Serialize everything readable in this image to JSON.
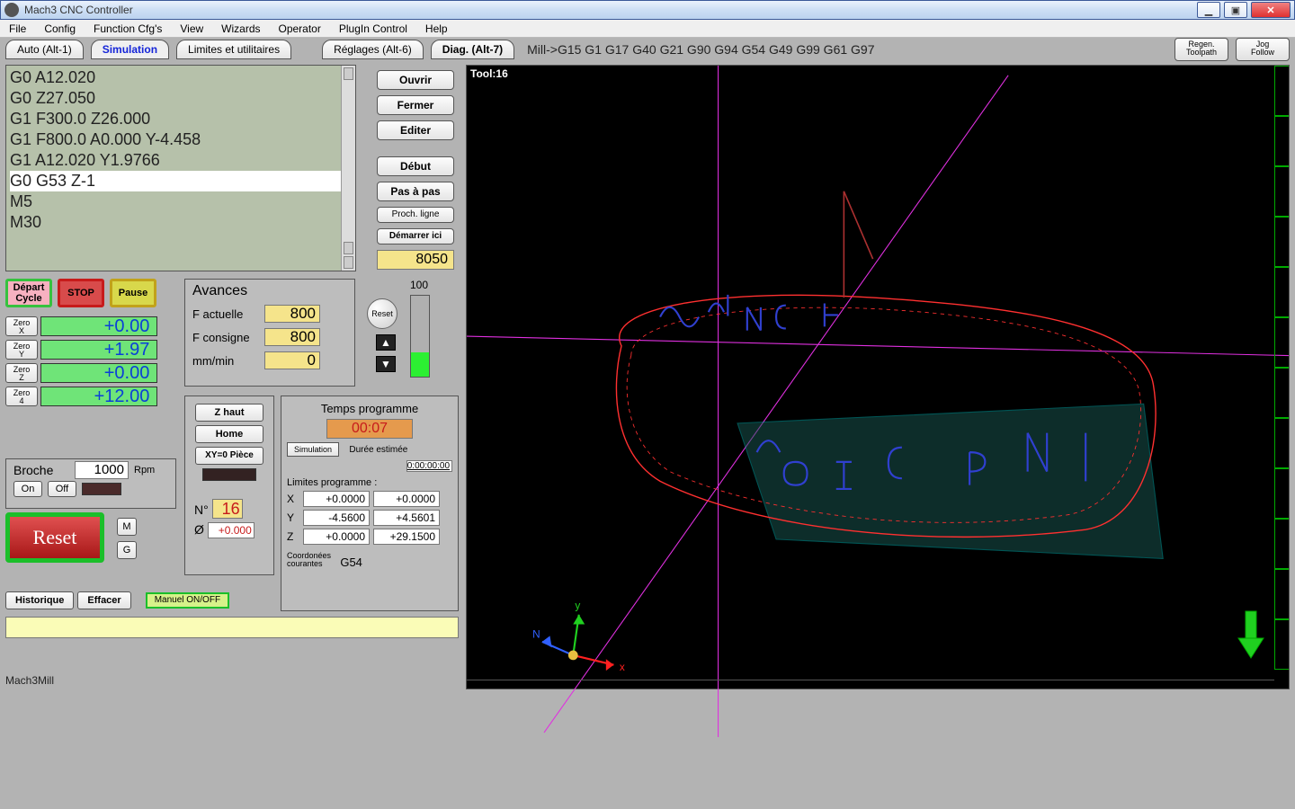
{
  "window": {
    "title": "Mach3 CNC Controller"
  },
  "menu": [
    "File",
    "Config",
    "Function Cfg's",
    "View",
    "Wizards",
    "Operator",
    "PlugIn Control",
    "Help"
  ],
  "tabs": {
    "auto": "Auto (Alt-1)",
    "sim": "Simulation",
    "limites": "Limites et utilitaires",
    "reglages": "Réglages (Alt-6)",
    "diag": "Diag. (Alt-7)"
  },
  "statusline": "Mill->G15  G1 G17 G40 G21 G90 G94 G54 G49 G99 G61 G97",
  "topright": {
    "regen": "Regen.\nToolpath",
    "jog": "Jog\nFollow"
  },
  "gcode": {
    "l1": "G0 A12.020",
    "l2": "G0 Z27.050",
    "l3": "G1 F300.0 Z26.000",
    "l4": "G1 F800.0 A0.000 Y-4.458",
    "l5": "G1 A12.020 Y1.9766",
    "l6": "G0 G53 Z-1",
    "l7": "M5",
    "l8": "M30"
  },
  "filebtns": {
    "ouvrir": "Ouvrir",
    "fermer": "Fermer",
    "editer": "Editer",
    "debut": "Début",
    "pas": "Pas à pas",
    "proch": "Proch. ligne",
    "demarrer": "Démarrer ici",
    "line": "8050"
  },
  "run": {
    "depart": "Départ\nCycle",
    "stop": "STOP",
    "pause": "Pause"
  },
  "zero": {
    "x": {
      "btn": "Zero\nX",
      "val": "+0.00"
    },
    "y": {
      "btn": "Zero\nY",
      "val": "+1.97"
    },
    "z": {
      "btn": "Zero\nZ",
      "val": "+0.00"
    },
    "a": {
      "btn": "Zero\n4",
      "val": "+12.00"
    }
  },
  "feed": {
    "title": "Avances",
    "actual_l": "F actuelle",
    "actual_v": "800",
    "cons_l": "F consigne",
    "cons_v": "800",
    "unit_l": "mm/min",
    "unit_v": "0",
    "reset": "Reset",
    "ov100": "100"
  },
  "broche": {
    "label": "Broche",
    "val": "1000",
    "rpm": "Rpm",
    "on": "On",
    "off": "Off"
  },
  "home": {
    "zhaut": "Z haut",
    "home": "Home",
    "xy0": "XY=0 Pièce",
    "n": "N°",
    "nval": "16",
    "dia": "Ø",
    "diaval": "+0.000"
  },
  "time": {
    "label": "Temps programme",
    "val": "00:07",
    "sim": "Simulation",
    "dur_l": "Durée estimée",
    "dur_v": "0:00:00:00",
    "lim_l": "Limites programme :",
    "x": {
      "min": "+0.0000",
      "max": "+0.0000"
    },
    "y": {
      "min": "-4.5600",
      "max": "+4.5601"
    },
    "z": {
      "min": "+0.0000",
      "max": "+29.1500"
    },
    "coord_l": "Coordonées\ncourantes",
    "coord_v": "G54"
  },
  "reset": {
    "label": "Reset",
    "m": "M",
    "g": "G"
  },
  "bottom": {
    "hist": "Historique",
    "effacer": "Effacer",
    "manuel": "Manuel ON/OFF"
  },
  "footer": "Mach3Mill",
  "tool": "Tool:16",
  "axes": {
    "x": "x",
    "y": "y",
    "n": "N"
  }
}
